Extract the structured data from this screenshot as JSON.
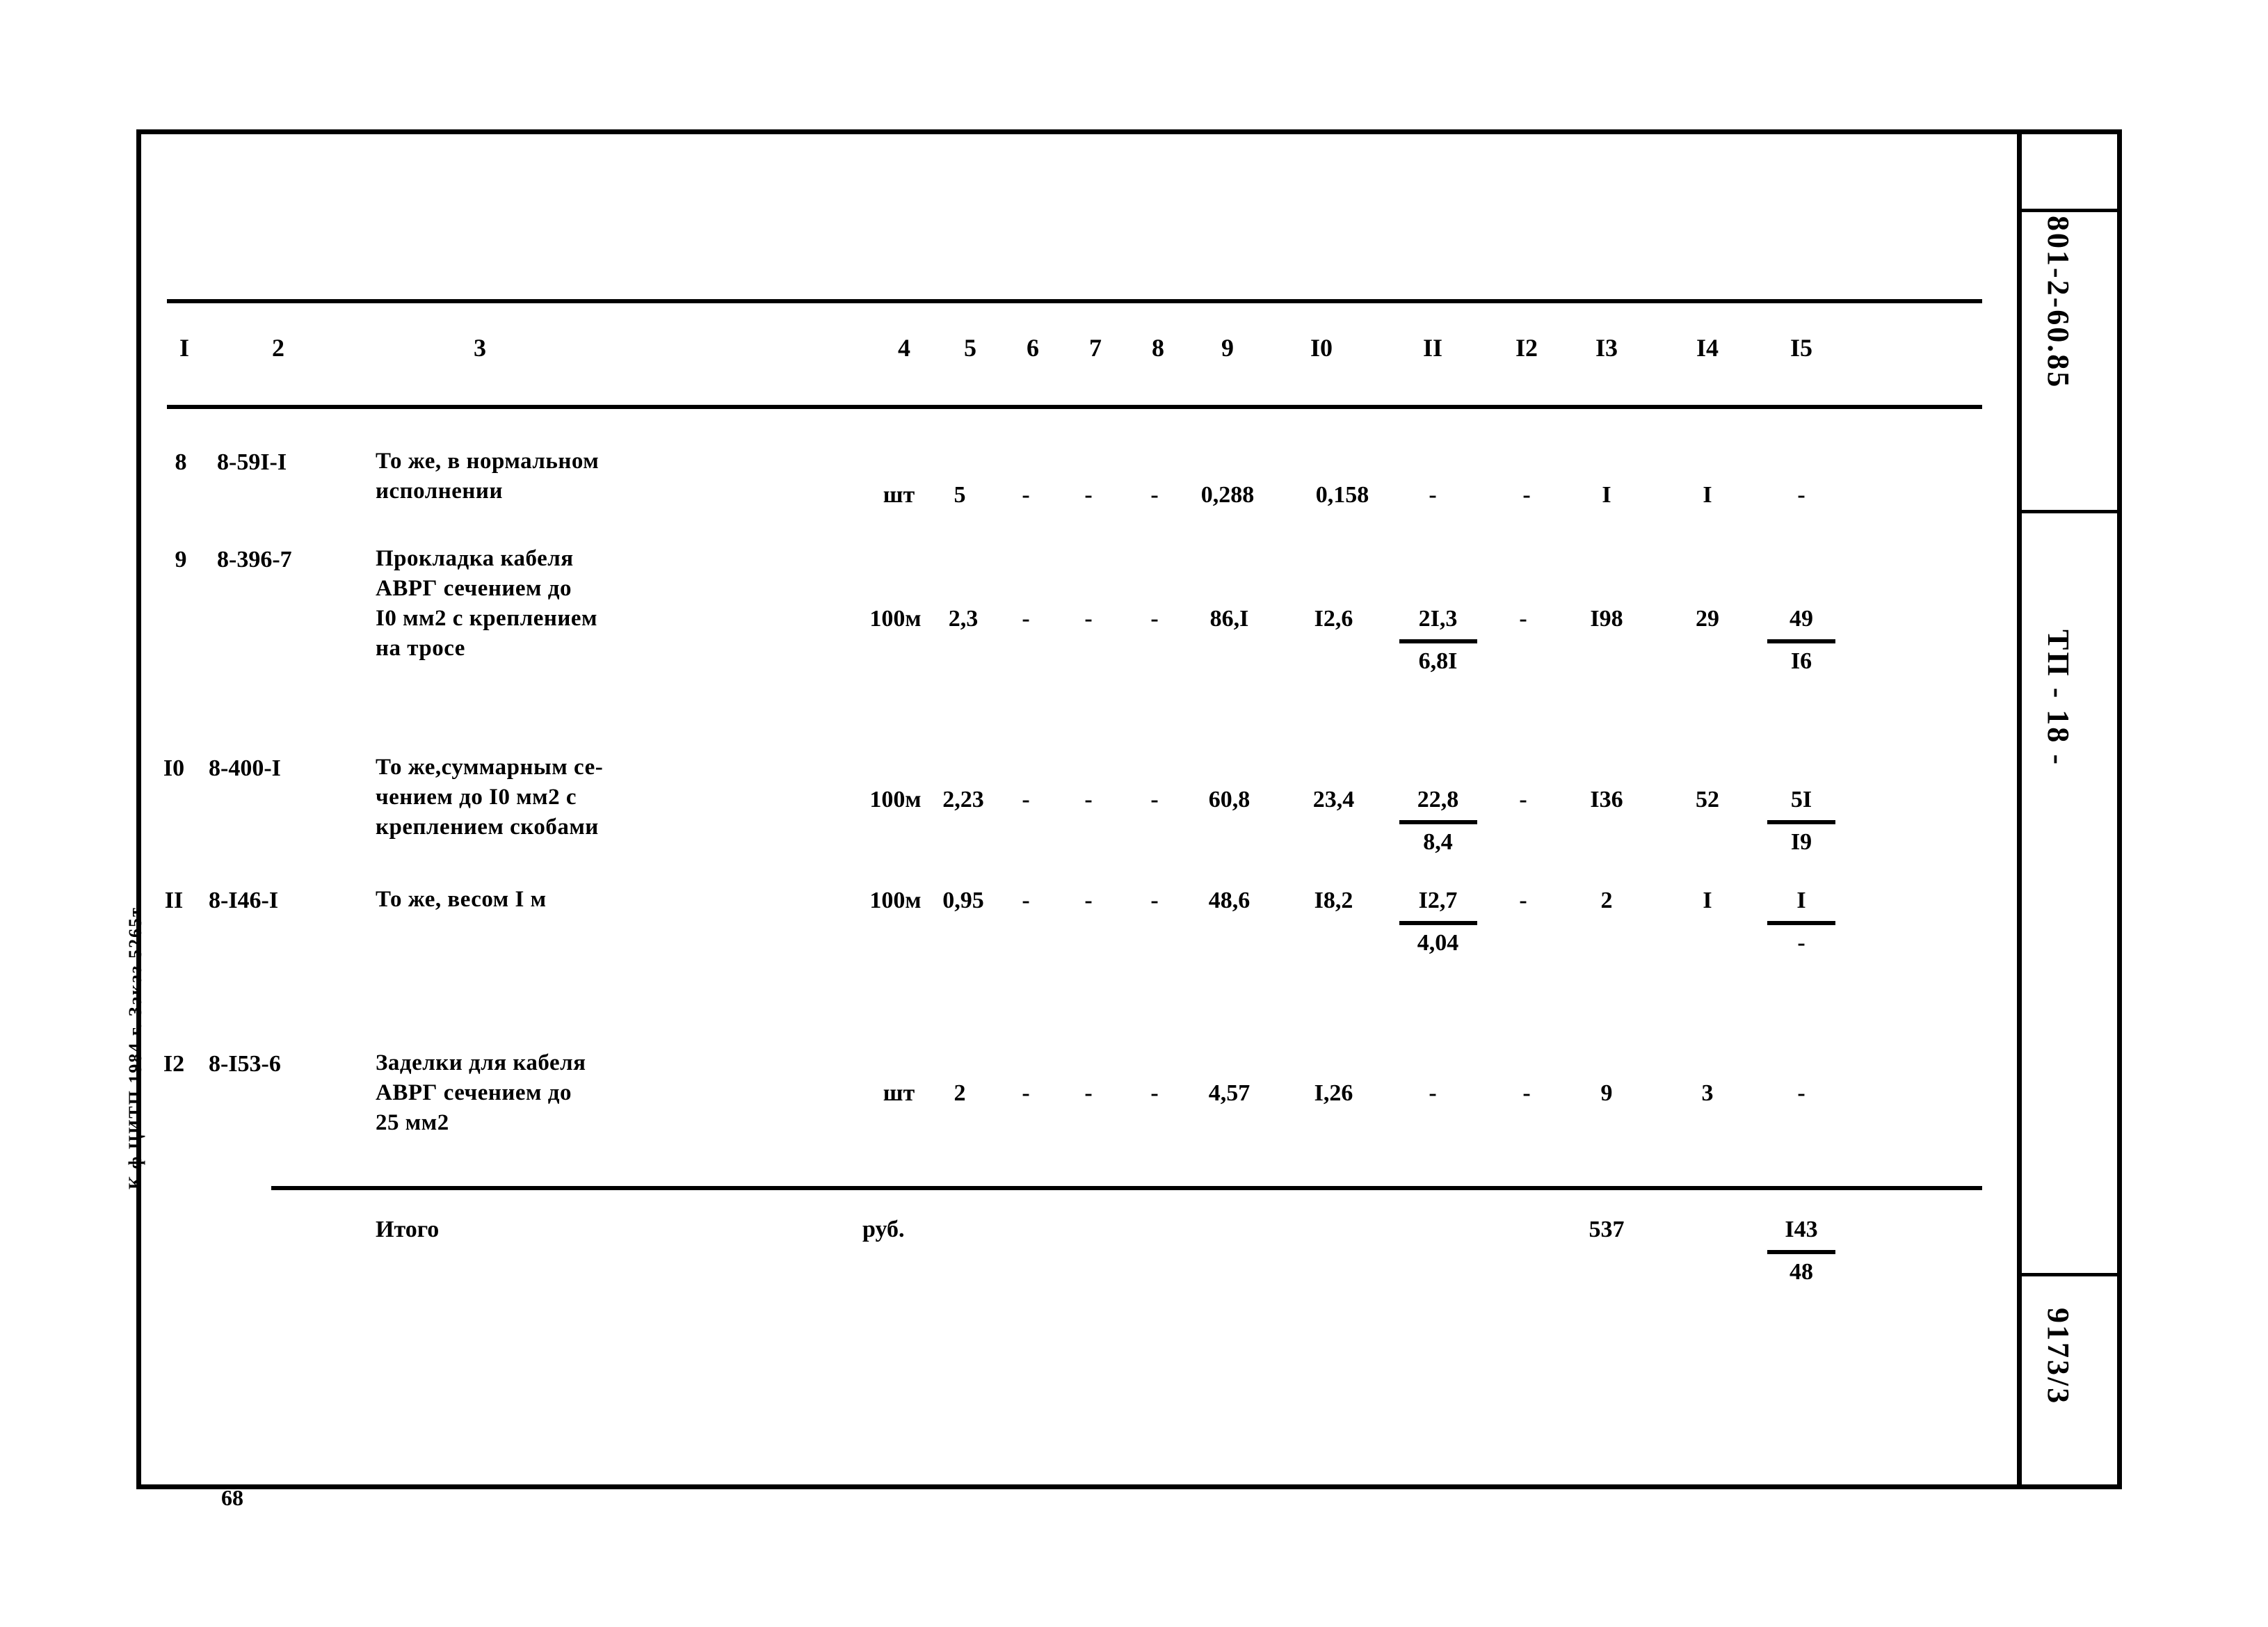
{
  "document": {
    "right_margin_top": "801-2-60.85",
    "right_margin_mid": "ТП - 18 -",
    "right_margin_bottom": "9173/3",
    "left_margin": "К ф ЦИТП 1984 г. Заказ 5265т",
    "page_number": "68"
  },
  "table": {
    "column_headers": [
      "I",
      "2",
      "3",
      "4",
      "5",
      "6",
      "7",
      "8",
      "9",
      "I0",
      "II",
      "I2",
      "I3",
      "I4",
      "I5"
    ],
    "rows": [
      {
        "no": "8",
        "code": "8-59I-I",
        "description": "То же, в нормальном\nисполнении",
        "unit": "шт",
        "c5": "5",
        "c6": "-",
        "c7": "-",
        "c8": "-",
        "c9": "0,288",
        "c10": "0,158",
        "c11": "-",
        "c11b": "",
        "c12": "-",
        "c13": "I",
        "c14": "I",
        "c15": "-",
        "c15b": ""
      },
      {
        "no": "9",
        "code": "8-396-7",
        "description": "Прокладка кабеля\nАВРГ сечением до\nI0 мм2 с креплением\nна тросе",
        "unit": "100м",
        "c5": "2,3",
        "c6": "-",
        "c7": "-",
        "c8": "-",
        "c9": "86,I",
        "c10": "I2,6",
        "c11": "2I,3",
        "c11b": "6,8I",
        "c12": "-",
        "c13": "I98",
        "c14": "29",
        "c15": "49",
        "c15b": "I6"
      },
      {
        "no": "I0",
        "code": "8-400-I",
        "description": "То же,суммарным се-\nчением до I0 мм2 с\nкреплением скобами",
        "unit": "100м",
        "c5": "2,23",
        "c6": "-",
        "c7": "-",
        "c8": "-",
        "c9": "60,8",
        "c10": "23,4",
        "c11": "22,8",
        "c11b": "8,4",
        "c12": "-",
        "c13": "I36",
        "c14": "52",
        "c15": "5I",
        "c15b": "I9"
      },
      {
        "no": "II",
        "code": "8-I46-I",
        "description": "То же, весом I м",
        "unit": "100м",
        "c5": "0,95",
        "c6": "-",
        "c7": "-",
        "c8": "-",
        "c9": "48,6",
        "c10": "I8,2",
        "c11": "I2,7",
        "c11b": "4,04",
        "c12": "-",
        "c13": "2",
        "c14": "I",
        "c15": "I",
        "c15b": "-"
      },
      {
        "no": "I2",
        "code": "8-I53-6",
        "description": "Заделки для кабеля\nАВРГ сечением до\n25 мм2",
        "unit": "шт",
        "c5": "2",
        "c6": "-",
        "c7": "-",
        "c8": "-",
        "c9": "4,57",
        "c10": "I,26",
        "c11": "-",
        "c11b": "",
        "c12": "-",
        "c13": "9",
        "c14": "3",
        "c15": "-",
        "c15b": ""
      }
    ],
    "total": {
      "label": "Итого",
      "unit": "руб.",
      "c13": "537",
      "c15": "I43",
      "c15b": "48"
    }
  }
}
